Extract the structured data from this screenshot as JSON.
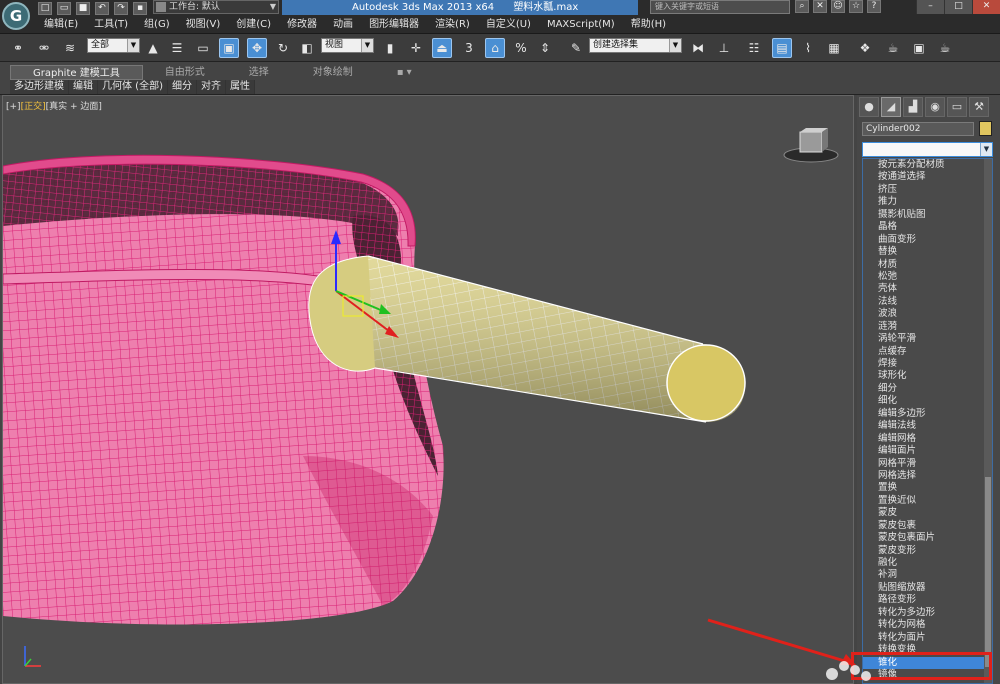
{
  "window": {
    "title_app": "Autodesk 3ds Max  2013 x64",
    "title_file": "塑料水瓢.max",
    "search_placeholder": "键入关键字或短语",
    "workspace_label": "工作台: 默认",
    "app_logo": "G"
  },
  "menus": [
    "编辑(E)",
    "工具(T)",
    "组(G)",
    "视图(V)",
    "创建(C)",
    "修改器",
    "动画",
    "图形编辑器",
    "渲染(R)",
    "自定义(U)",
    "MAXScript(M)",
    "帮助(H)"
  ],
  "toolbar": {
    "selection_filter": "全部",
    "ref_coord": "视图",
    "named_selection": "创建选择集",
    "snap_label": "3",
    "percent_snap": "%"
  },
  "ribbon": {
    "tabs": [
      "Graphite 建模工具",
      "自由形式",
      "选择",
      "对象绘制"
    ],
    "subtabs": [
      "多边形建模",
      "编辑",
      "几何体 (全部)",
      "细分",
      "对齐",
      "属性"
    ]
  },
  "viewport": {
    "label_prefix": "[+]",
    "label_active": "[正交]",
    "label_suffix": "[真实 + 边面]"
  },
  "command_panel": {
    "object_name": "Cylinder002",
    "object_color": "#e0c660",
    "tab_icons": [
      "sun-icon",
      "modify-icon",
      "hierarchy-icon",
      "motion-icon",
      "display-icon",
      "utilities-icon"
    ],
    "modifier_list": [
      "按元素分配材质",
      "按通道选择",
      "挤压",
      "推力",
      "摄影机贴图",
      "晶格",
      "曲面变形",
      "替换",
      "材质",
      "松弛",
      "壳体",
      "法线",
      "波浪",
      "涟漪",
      "涡轮平滑",
      "点缓存",
      "焊接",
      "球形化",
      "细分",
      "细化",
      "编辑多边形",
      "编辑法线",
      "编辑网格",
      "编辑面片",
      "网格平滑",
      "网格选择",
      "置换",
      "置换近似",
      "蒙皮",
      "蒙皮包裹",
      "蒙皮包裹面片",
      "蒙皮变形",
      "融化",
      "补洞",
      "贴图缩放器",
      "路径变形",
      "转化为多边形",
      "转化为网格",
      "转化为面片",
      "转换变换",
      "锥化",
      "镜像"
    ],
    "selected_modifier": "锥化"
  },
  "colors": {
    "accent": "#4a8fd3",
    "pot_wire": "#d81f74",
    "handle_fill": "#d8cc7a",
    "highlight_box": "#e0211a"
  }
}
